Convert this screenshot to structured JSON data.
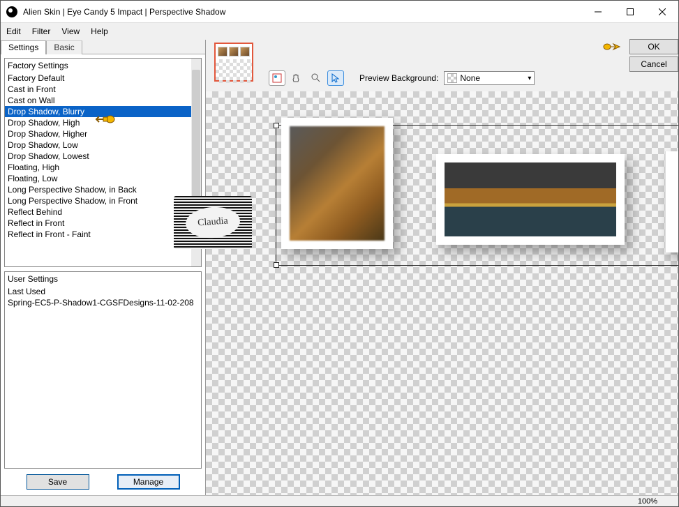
{
  "window": {
    "title": "Alien Skin | Eye Candy 5 Impact | Perspective Shadow"
  },
  "menu": {
    "edit": "Edit",
    "filter": "Filter",
    "view": "View",
    "help": "Help"
  },
  "tabs": {
    "settings": "Settings",
    "basic": "Basic"
  },
  "factory": {
    "header": "Factory Settings",
    "items": [
      "Factory Default",
      "Cast in Front",
      "Cast on Wall",
      "Drop Shadow, Blurry",
      "Drop Shadow, High",
      "Drop Shadow, Higher",
      "Drop Shadow, Low",
      "Drop Shadow, Lowest",
      "Floating, High",
      "Floating, Low",
      "Long Perspective Shadow, in Back",
      "Long Perspective Shadow, in Front",
      "Reflect Behind",
      "Reflect in Front",
      "Reflect in Front - Faint"
    ],
    "selected_index": 3
  },
  "user": {
    "header": "User Settings",
    "items": [
      "Last Used",
      "Spring-EC5-P-Shadow1-CGSFDesigns-11-02-208"
    ]
  },
  "buttons": {
    "save": "Save",
    "manage": "Manage",
    "ok": "OK",
    "cancel": "Cancel"
  },
  "preview": {
    "label": "Preview Background:",
    "value": "None"
  },
  "status": {
    "zoom": "100%"
  },
  "watermark": {
    "text": "Claudia"
  }
}
